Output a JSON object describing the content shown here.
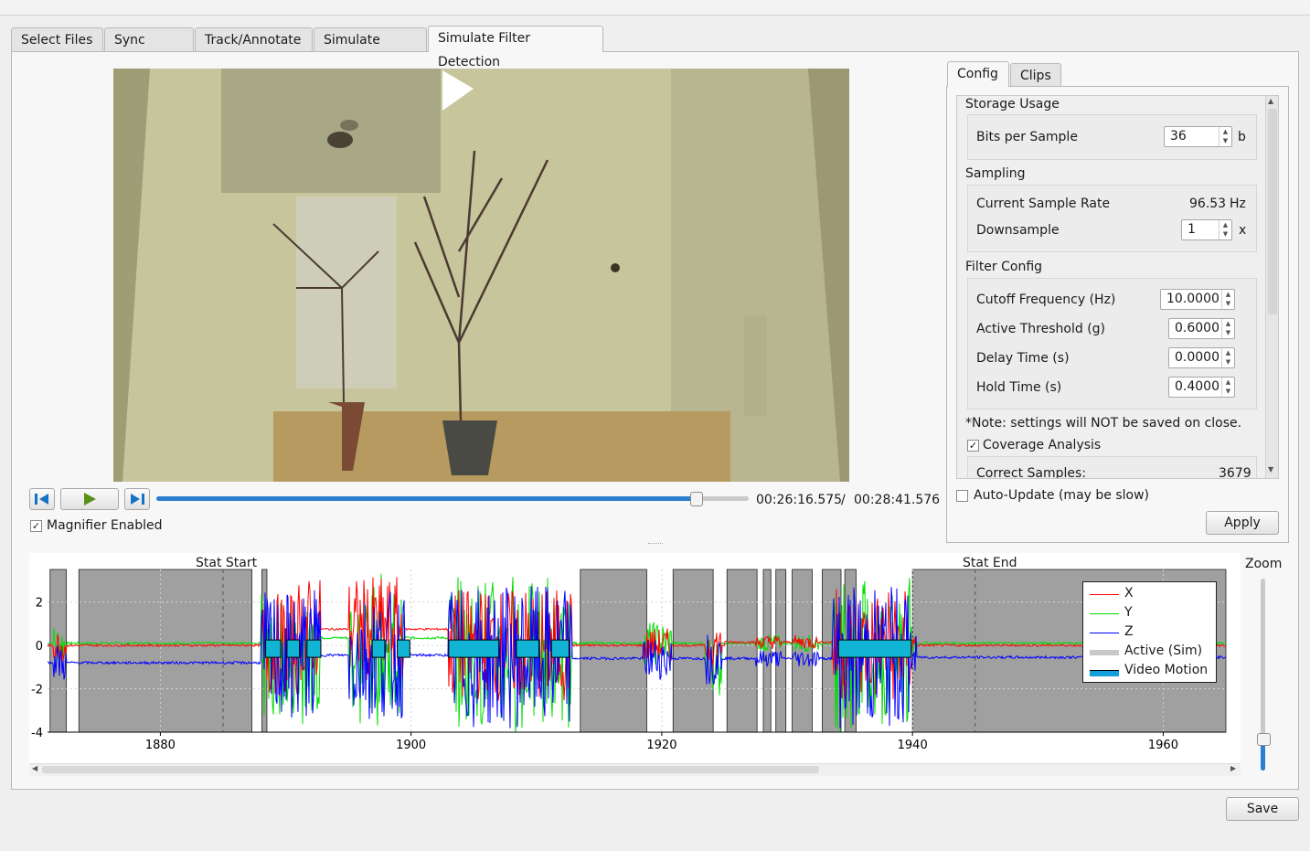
{
  "tabs": [
    "Select Files",
    "Sync Video",
    "Track/Annotate",
    "Simulate ADXL",
    "Simulate Filter Detection"
  ],
  "player": {
    "current_time": "00:26:16.575",
    "separator": "/",
    "total_time": "00:28:41.576",
    "progress": 0.91,
    "magnifier_label": "Magnifier Enabled",
    "magnifier_checked": true
  },
  "side_tabs": [
    "Config",
    "Clips"
  ],
  "config": {
    "storage_header": "Storage Usage",
    "bits_label": "Bits per Sample",
    "bits_value": "36",
    "bits_unit": "b",
    "sampling_header": "Sampling",
    "rate_label": "Current Sample Rate",
    "rate_value": "96.53",
    "rate_unit": "Hz",
    "downsample_label": "Downsample",
    "downsample_value": "1",
    "downsample_unit": "x",
    "filter_header": "Filter Config",
    "cutoff_label": "Cutoff Frequency (Hz)",
    "cutoff_value": "10.0000",
    "threshold_label": "Active Threshold (g)",
    "threshold_value": "0.6000",
    "delay_label": "Delay Time (s)",
    "delay_value": "0.0000",
    "hold_label": "Hold Time (s)",
    "hold_value": "0.4000",
    "note": "*Note: settings will NOT be saved on close.",
    "coverage_label": "Coverage Analysis",
    "coverage_checked": true,
    "correct_label": "Correct Samples:",
    "correct_value": "3679",
    "auto_update_label": "Auto-Update (may be slow)",
    "auto_update_checked": false,
    "apply_label": "Apply"
  },
  "plot": {
    "stat_start": "Stat Start",
    "stat_end": "Stat End",
    "zoom_label": "Zoom",
    "y_ticks": [
      "2",
      "0",
      "-2",
      "-4"
    ],
    "x_ticks": [
      "1880",
      "1900",
      "1920",
      "1940",
      "1960"
    ],
    "legend": [
      "X",
      "Y",
      "Z",
      "Active (Sim)",
      "Video Motion"
    ]
  },
  "chart_data": {
    "type": "line",
    "xlim": [
      1871,
      1965
    ],
    "ylim": [
      -4,
      3.5
    ],
    "series": [
      {
        "name": "X",
        "color": "#ff0000"
      },
      {
        "name": "Y",
        "color": "#00dd00"
      },
      {
        "name": "Z",
        "color": "#0000ff"
      }
    ],
    "active_sim_ranges": [
      [
        1871.2,
        1872.5
      ],
      [
        1873.5,
        1887.3
      ],
      [
        1888.1,
        1888.5
      ],
      [
        1913.5,
        1918.8
      ],
      [
        1920.9,
        1924.1
      ],
      [
        1925.2,
        1927.6
      ],
      [
        1928.1,
        1928.7
      ],
      [
        1929.1,
        1929.9
      ],
      [
        1930.4,
        1932.0
      ],
      [
        1932.8,
        1934.3
      ],
      [
        1934.6,
        1935.5
      ],
      [
        1940.0,
        1965.0
      ]
    ],
    "video_motion_ranges": [
      [
        1888.4,
        1889.6
      ],
      [
        1890.1,
        1891.1
      ],
      [
        1891.7,
        1892.8
      ],
      [
        1896.9,
        1897.9
      ],
      [
        1898.9,
        1899.9
      ],
      [
        1903.0,
        1907.0
      ],
      [
        1908.4,
        1910.2
      ],
      [
        1911.2,
        1912.6
      ],
      [
        1934.1,
        1939.9
      ]
    ],
    "stat_start_x": 1885,
    "stat_end_x": 1945,
    "legend_position": "top-right",
    "grid": true
  },
  "save_label": "Save"
}
